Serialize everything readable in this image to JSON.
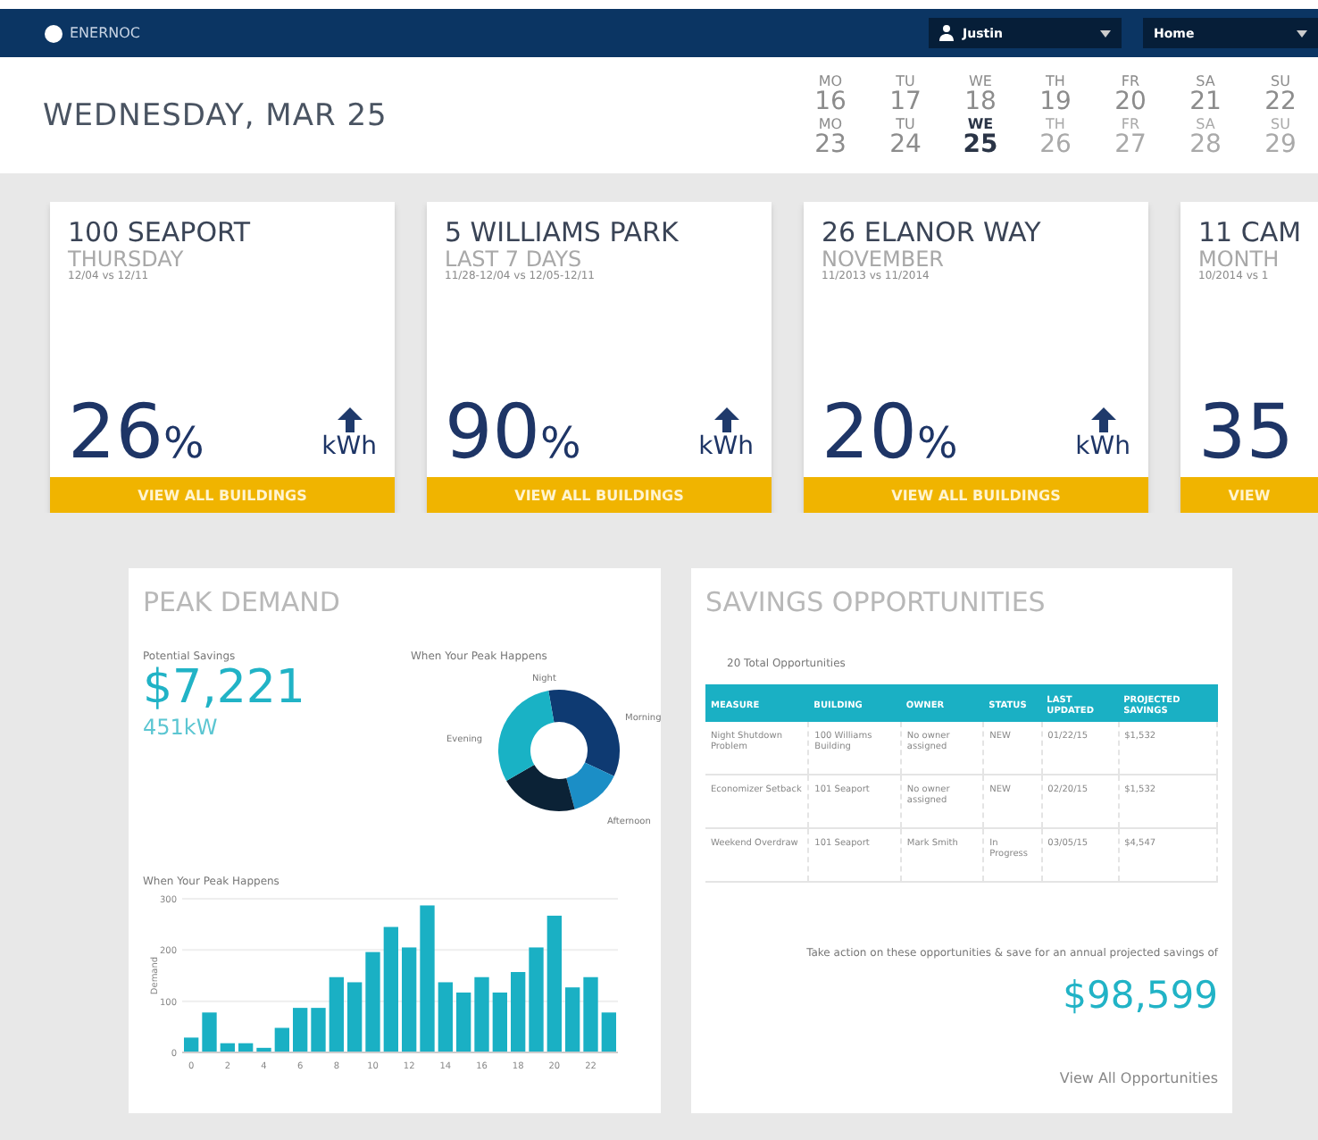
{
  "header": {
    "logo": "ENERNOC",
    "user": "Justin",
    "nav": "Home"
  },
  "date_title": "WEDNESDAY, MAR 25",
  "calendar": [
    [
      {
        "day": "MO",
        "date": "16",
        "selected": false,
        "future": false
      },
      {
        "day": "TU",
        "date": "17",
        "selected": false,
        "future": false
      },
      {
        "day": "WE",
        "date": "18",
        "selected": false,
        "future": false
      },
      {
        "day": "TH",
        "date": "19",
        "selected": false,
        "future": false
      },
      {
        "day": "FR",
        "date": "20",
        "selected": false,
        "future": false
      },
      {
        "day": "SA",
        "date": "21",
        "selected": false,
        "future": false
      },
      {
        "day": "SU",
        "date": "22",
        "selected": false,
        "future": false
      }
    ],
    [
      {
        "day": "MO",
        "date": "23",
        "selected": false,
        "future": false
      },
      {
        "day": "TU",
        "date": "24",
        "selected": false,
        "future": false
      },
      {
        "day": "WE",
        "date": "25",
        "selected": true,
        "future": false
      },
      {
        "day": "TH",
        "date": "26",
        "selected": false,
        "future": true
      },
      {
        "day": "FR",
        "date": "27",
        "selected": false,
        "future": true
      },
      {
        "day": "SA",
        "date": "28",
        "selected": false,
        "future": true
      },
      {
        "day": "SU",
        "date": "29",
        "selected": false,
        "future": true
      }
    ]
  ],
  "buildings": [
    {
      "name": "100 SEAPORT",
      "period": "THURSDAY",
      "range": "12/04 vs 12/11",
      "value": "26",
      "unit": "%",
      "metric": "kWh",
      "button": "VIEW ALL BUILDINGS"
    },
    {
      "name": "5 WILLIAMS PARK",
      "period": "LAST 7 DAYS",
      "range": "11/28-12/04 vs 12/05-12/11",
      "value": "90",
      "unit": "%",
      "metric": "kWh",
      "button": "VIEW ALL BUILDINGS"
    },
    {
      "name": "26 ELANOR WAY",
      "period": "NOVEMBER",
      "range": "11/2013 vs 11/2014",
      "value": "20",
      "unit": "%",
      "metric": "kWh",
      "button": "VIEW ALL BUILDINGS"
    },
    {
      "name": "11 CAM",
      "period": "MONTH",
      "range": "10/2014 vs 1",
      "value": "35",
      "button": "VIEW"
    }
  ],
  "peak_demand": {
    "title": "PEAK DEMAND",
    "savings_label": "Potential Savings",
    "savings": "$7,221",
    "demand": "451kW",
    "donut": {
      "title": "When Your Peak Happens",
      "labels": [
        "Night",
        "Morning",
        "Afternoon",
        "Evening"
      ]
    },
    "bars": {
      "chart_data": {
        "type": "bar",
        "title": "When Your Peak Happens",
        "xlim": [
          -0.5,
          23.5
        ],
        "x": [
          0,
          1,
          2,
          3,
          4,
          5,
          6,
          7,
          8,
          9,
          10,
          11,
          12,
          13,
          14,
          15,
          16,
          17,
          18,
          19,
          20,
          21,
          22,
          23
        ],
        "series": [
          {
            "name": "Demand",
            "color": "#1ab0c4",
            "values": [
              29,
              78,
              18,
              18,
              9,
              48,
              87,
              87,
              147,
              137,
              196,
              245,
              205,
              287,
              137,
              117,
              147,
              117,
              157,
              205,
              267,
              127,
              147,
              78
            ]
          }
        ],
        "ylim": [
          0,
          300
        ],
        "yticks": [
          0,
          100,
          200,
          300
        ],
        "xticks": [
          0,
          2,
          4,
          6,
          8,
          10,
          12,
          14,
          16,
          18,
          20,
          22
        ]
      }
    }
  },
  "savings_opportunities": {
    "title": "SAVINGS OPPORTUNITIES",
    "count": "20 Total Opportunities",
    "columns": [
      "MEASURE",
      "BUILDING",
      "OWNER",
      "STATUS",
      "LAST UPDATED",
      "PROJECTED SAVINGS"
    ],
    "rows": [
      [
        "Night Shutdown Problem",
        "100 Williams Building",
        "No owner assigned",
        "NEW",
        "01/22/15",
        "$1,532"
      ],
      [
        "Economizer Setback",
        "101 Seaport",
        "No owner assigned",
        "NEW",
        "02/20/15",
        "$1,532"
      ],
      [
        "Weekend Overdraw",
        "101 Seaport",
        "Mark Smith",
        "In Progress",
        "03/05/15",
        "$4,547"
      ]
    ],
    "note": "Take action on these opportunities & save for an annual projected savings of",
    "total": "$98,599",
    "link": "View All Opportunities"
  }
}
